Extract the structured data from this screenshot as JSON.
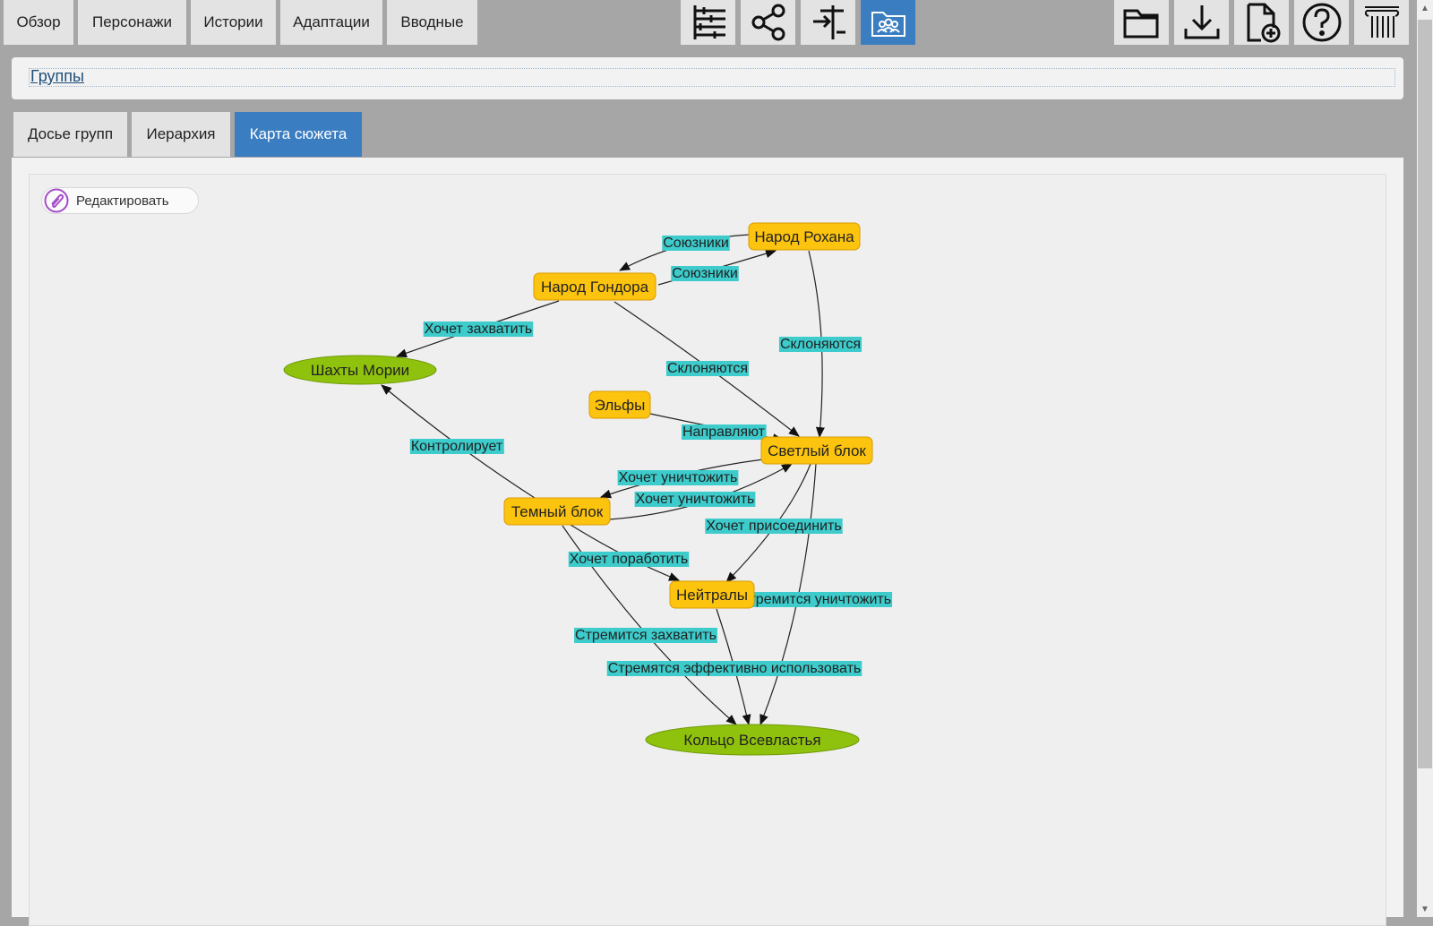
{
  "nav": {
    "tabs": [
      "Обзор",
      "Персонажи",
      "Истории",
      "Адаптации",
      "Вводные"
    ],
    "center_icons": [
      "timeline-icon",
      "share-icon",
      "split-icon",
      "group-folder-icon"
    ],
    "right_icons": [
      "folder-icon",
      "download-icon",
      "new-file-icon",
      "help-icon",
      "column-icon"
    ]
  },
  "breadcrumb": {
    "link": "Группы"
  },
  "subtabs": [
    "Досье групп",
    "Иерархия",
    "Карта сюжета"
  ],
  "active_subtab": "Карта сюжета",
  "toolbar": {
    "edit_label": "Редактировать"
  },
  "graph": {
    "nodes": [
      {
        "id": "rohan",
        "label": "Народ Рохана",
        "shape": "box",
        "color": "#fdc40f"
      },
      {
        "id": "gondor",
        "label": "Народ Гондора",
        "shape": "box",
        "color": "#fdc40f"
      },
      {
        "id": "moria",
        "label": "Шахты Мории",
        "shape": "ellipse",
        "color": "#8fc20c"
      },
      {
        "id": "elves",
        "label": "Эльфы",
        "shape": "box",
        "color": "#fdc40f"
      },
      {
        "id": "light",
        "label": "Светлый блок",
        "shape": "box",
        "color": "#fdc40f"
      },
      {
        "id": "dark",
        "label": "Темный блок",
        "shape": "box",
        "color": "#fdc40f"
      },
      {
        "id": "neutral",
        "label": "Нейтралы",
        "shape": "box",
        "color": "#fdc40f"
      },
      {
        "id": "ring",
        "label": "Кольцо Всевластья",
        "shape": "ellipse",
        "color": "#8fc20c"
      }
    ],
    "edges": [
      {
        "from": "rohan",
        "to": "gondor",
        "label": "Союзники"
      },
      {
        "from": "gondor",
        "to": "rohan",
        "label": "Союзники"
      },
      {
        "from": "gondor",
        "to": "moria",
        "label": "Хочет захватить"
      },
      {
        "from": "rohan",
        "to": "light",
        "label": "Склоняются"
      },
      {
        "from": "gondor",
        "to": "light",
        "label": "Склоняются"
      },
      {
        "from": "elves",
        "to": "light",
        "label": "Направляют"
      },
      {
        "from": "dark",
        "to": "moria",
        "label": "Контролирует"
      },
      {
        "from": "light",
        "to": "dark",
        "label": "Хочет уничтожить"
      },
      {
        "from": "dark",
        "to": "light",
        "label": "Хочет уничтожить"
      },
      {
        "from": "light",
        "to": "neutral",
        "label": "Хочет присоединить"
      },
      {
        "from": "dark",
        "to": "neutral",
        "label": "Хочет поработить"
      },
      {
        "from": "light",
        "to": "ring",
        "label": "Стремится уничтожить"
      },
      {
        "from": "dark",
        "to": "ring",
        "label": "Стремится захватить"
      },
      {
        "from": "neutral",
        "to": "ring",
        "label": "Стремятся эффективно использовать"
      }
    ],
    "edge_label_color": "#3dcbcb",
    "edge_color": "#222222"
  }
}
